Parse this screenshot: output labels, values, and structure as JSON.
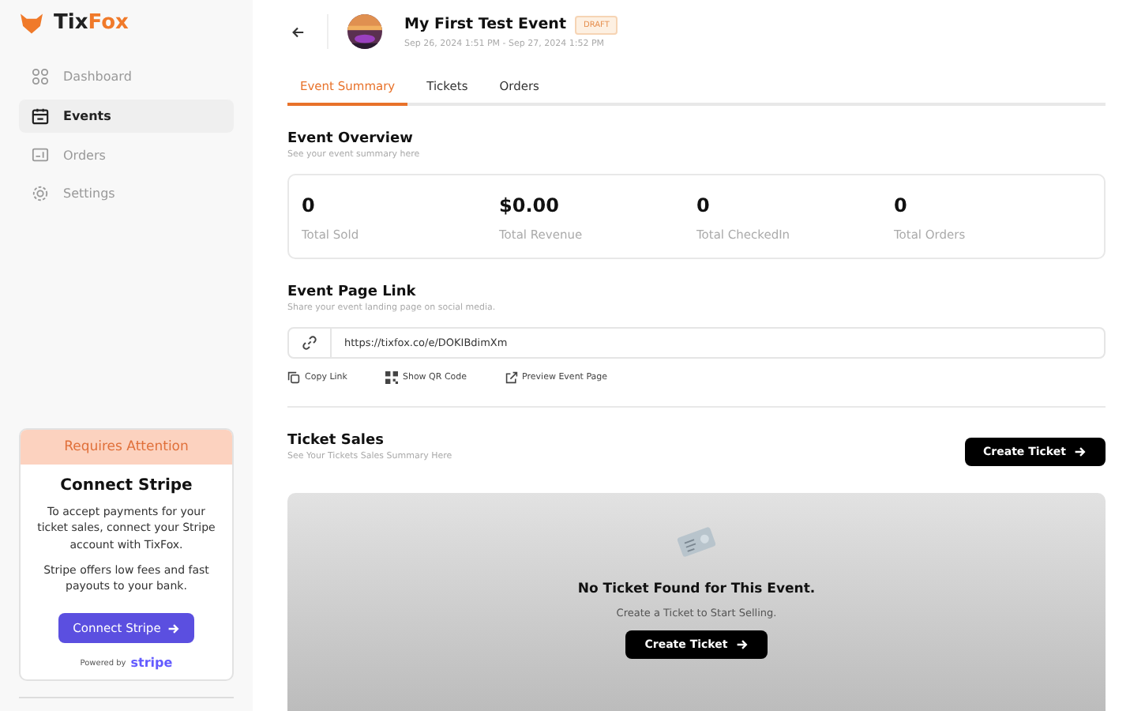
{
  "brand": {
    "name_dark": "Tix",
    "name_accent": "Fox"
  },
  "sidebar": {
    "items": [
      {
        "label": "Dashboard",
        "kind": "grid",
        "selected": false
      },
      {
        "label": "Events",
        "kind": "calendar",
        "selected": true
      },
      {
        "label": "Orders",
        "kind": "ticket",
        "selected": false
      },
      {
        "label": "Settings",
        "kind": "gear",
        "selected": false
      }
    ]
  },
  "stripe_card": {
    "banner": "Requires Attention",
    "title": "Connect Stripe",
    "paragraphs": [
      "To accept payments for your ticket sales, connect your Stripe account with TixFox.",
      "Stripe offers low fees and fast payouts to your bank."
    ],
    "button": "Connect Stripe",
    "powered_by": "Powered by",
    "provider": "stripe"
  },
  "event": {
    "title": "My First Test Event",
    "status": "DRAFT",
    "dates": "Sep 26, 2024 1:51 PM - Sep 27, 2024 1:52 PM"
  },
  "tabs": [
    {
      "label": "Event Summary",
      "selected": true
    },
    {
      "label": "Tickets",
      "selected": false
    },
    {
      "label": "Orders",
      "selected": false
    }
  ],
  "overview": {
    "title": "Event Overview",
    "subtitle": "See your event summary here",
    "stats": [
      {
        "value": "0",
        "label": "Total Sold"
      },
      {
        "value": "$0.00",
        "label": "Total Revenue"
      },
      {
        "value": "0",
        "label": "Total CheckedIn"
      },
      {
        "value": "0",
        "label": "Total Orders"
      }
    ]
  },
  "page_link": {
    "title": "Event Page Link",
    "subtitle": "Share your event landing page on social media.",
    "url": "https://tixfox.co/e/DOKIBdimXm",
    "actions": [
      {
        "label": "Copy Link",
        "kind": "copy"
      },
      {
        "label": "Show QR Code",
        "kind": "qr"
      },
      {
        "label": "Preview Event Page",
        "kind": "external"
      }
    ]
  },
  "ticket_sales": {
    "title": "Ticket Sales",
    "subtitle": "See Your Tickets Sales Summary Here",
    "button": "Create Ticket",
    "empty_title": "No Ticket Found for This Event.",
    "empty_subtitle": "Create a Ticket to Start Selling.",
    "empty_button": "Create Ticket"
  }
}
